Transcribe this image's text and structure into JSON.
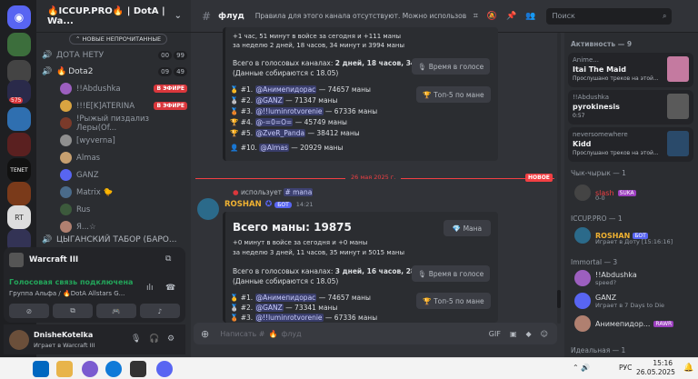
{
  "server": {
    "name": "🔥ICCUP.PRO🔥 | DotA | Wa..."
  },
  "unread_pill": "НОВЫЕ НЕПРОЧИТАННЫЕ",
  "channels": [
    {
      "name": "ДОТА НЕТУ",
      "c1": "00",
      "c2": "99"
    },
    {
      "name": "Dota2",
      "c1": "09",
      "c2": "49"
    }
  ],
  "voice_users": [
    {
      "name": "!!Abdushka",
      "live": "В ЭФИРЕ",
      "color": "#9c5fbf"
    },
    {
      "name": "!!!E[K]ATERINA",
      "live": "В ЭФИРЕ",
      "color": "#d9a441"
    },
    {
      "name": "!Рыжый пиздализ Леры(Of...",
      "live": "",
      "color": "#7a3a2a"
    },
    {
      "name": "[wyverna]",
      "live": "",
      "color": "#8f8f8f"
    },
    {
      "name": "Almas",
      "live": "",
      "color": "#c7a070"
    },
    {
      "name": "GANZ",
      "live": "",
      "color": "#5865f2"
    },
    {
      "name": "Matrix 🐤",
      "live": "",
      "color": "#4a6b8a"
    },
    {
      "name": "Rus",
      "live": "",
      "color": "#3c5a3c"
    },
    {
      "name": "Я...☆",
      "live": "",
      "color": "#b08070"
    }
  ],
  "gypsy_channel": "ЦЫГАНСКИЙ ТАБОР (БАРО...",
  "game": {
    "name": "Warcraft III"
  },
  "voice_panel": {
    "status": "Голосовая связь подключена",
    "channel": "Группа Альфа / 🔥DotA Allstars G..."
  },
  "self": {
    "name": "DnisheKotelka",
    "status": "Играет в Warcraft III"
  },
  "topbar": {
    "channel": "флуд",
    "topic": "Правила для этого канала отсутствуют. Можно использовать к...",
    "search": "Поиск"
  },
  "msg1": {
    "line1": "+1 час, 51 минут в войсе за сегодня и +111 маны",
    "line2": "за неделю 2 дней, 18 часов, 34 минут и 3994 маны",
    "voice_total_prefix": "Всего в голосовых каналах: ",
    "voice_total": "2 дней, 18 часов, 34 минут",
    "collected": "(Данные собираются с 18.05)",
    "btn_voice": "Время в голосе",
    "btn_top": "Топ-5 по мане",
    "ranks": [
      {
        "pos": "#1.",
        "name": "@Анимепидорас",
        "mana": "— 74657 маны"
      },
      {
        "pos": "#2.",
        "name": "@GANZ",
        "mana": "— 71347 маны"
      },
      {
        "pos": "#3.",
        "name": "@!!luminrotvorenie",
        "mana": "— 67336 маны"
      },
      {
        "pos": "#4.",
        "name": "@-=0=O=",
        "mana": "— 45749 маны"
      },
      {
        "pos": "#5.",
        "name": "@ZveR_Panda",
        "mana": "— 38412 маны"
      },
      {
        "pos": "#10.",
        "name": "@Almas",
        "mana": "— 20929 маны"
      }
    ]
  },
  "divider": {
    "date": "26 мая 2025 г.",
    "new": "НОВОЕ"
  },
  "msg2": {
    "ref_action": "использует",
    "ref_cmd": "mana",
    "author": "ROSHAN",
    "bot": "БОТ",
    "time": "14:21",
    "title": "Всего маны: 19875",
    "btn_mana": "Мана",
    "line1": "+0 минут в войсе за сегодня и +0 маны",
    "line2": "за неделю 3 дней, 11 часов, 35 минут и 5015 маны",
    "voice_total_prefix": "Всего в голосовых каналах: ",
    "voice_total": "3 дней, 16 часов, 28 минут",
    "collected": "(Данные собираются с 18.05)",
    "btn_voice": "Время в голосе",
    "btn_top": "Топ-5 по мане",
    "ranks": [
      {
        "pos": "#1.",
        "name": "@Анимепидорас",
        "mana": "— 74657 маны"
      },
      {
        "pos": "#2.",
        "name": "@GANZ",
        "mana": "— 73341 маны"
      },
      {
        "pos": "#3.",
        "name": "@!!luminrotvorenie",
        "mana": "— 67336 маны"
      }
    ]
  },
  "composer": {
    "placeholder": "Написать #",
    "channel": "флуд"
  },
  "members": {
    "activity_header": "Активность — 9",
    "activities": [
      {
        "name": "Anime...",
        "title": "Itai The Maid",
        "sub": "Прослушано треков на этой..."
      },
      {
        "name": "!!Abdushka",
        "title": "pyrokinesis",
        "sub": "0:57"
      },
      {
        "name": "neversomewhere",
        "title": "Kidd",
        "sub": "Прослушано треков на этой..."
      }
    ],
    "sections": [
      {
        "title": "Чык-чырык — 1"
      },
      {
        "title": "ICCUP.PRO — 1"
      },
      {
        "title": "Immortal — 3"
      },
      {
        "title": "Идеальная — 1"
      }
    ],
    "slash": {
      "name": "slash",
      "tag": "SUKA",
      "sub": "0-0"
    },
    "roshan": {
      "name": "ROSHAN",
      "bot": "БОТ",
      "sub": "Играет в Доту [15:16:16]"
    },
    "immortal": [
      {
        "name": "!!Abdushka",
        "sub": "speed?"
      },
      {
        "name": "GANZ",
        "sub": "Играет в 7 Days to Die"
      },
      {
        "name": "Анимепидор...",
        "tag": "RAWR"
      }
    ]
  },
  "taskbar": {
    "lang": "РУС",
    "time": "15:16",
    "date": "26.05.2025"
  }
}
